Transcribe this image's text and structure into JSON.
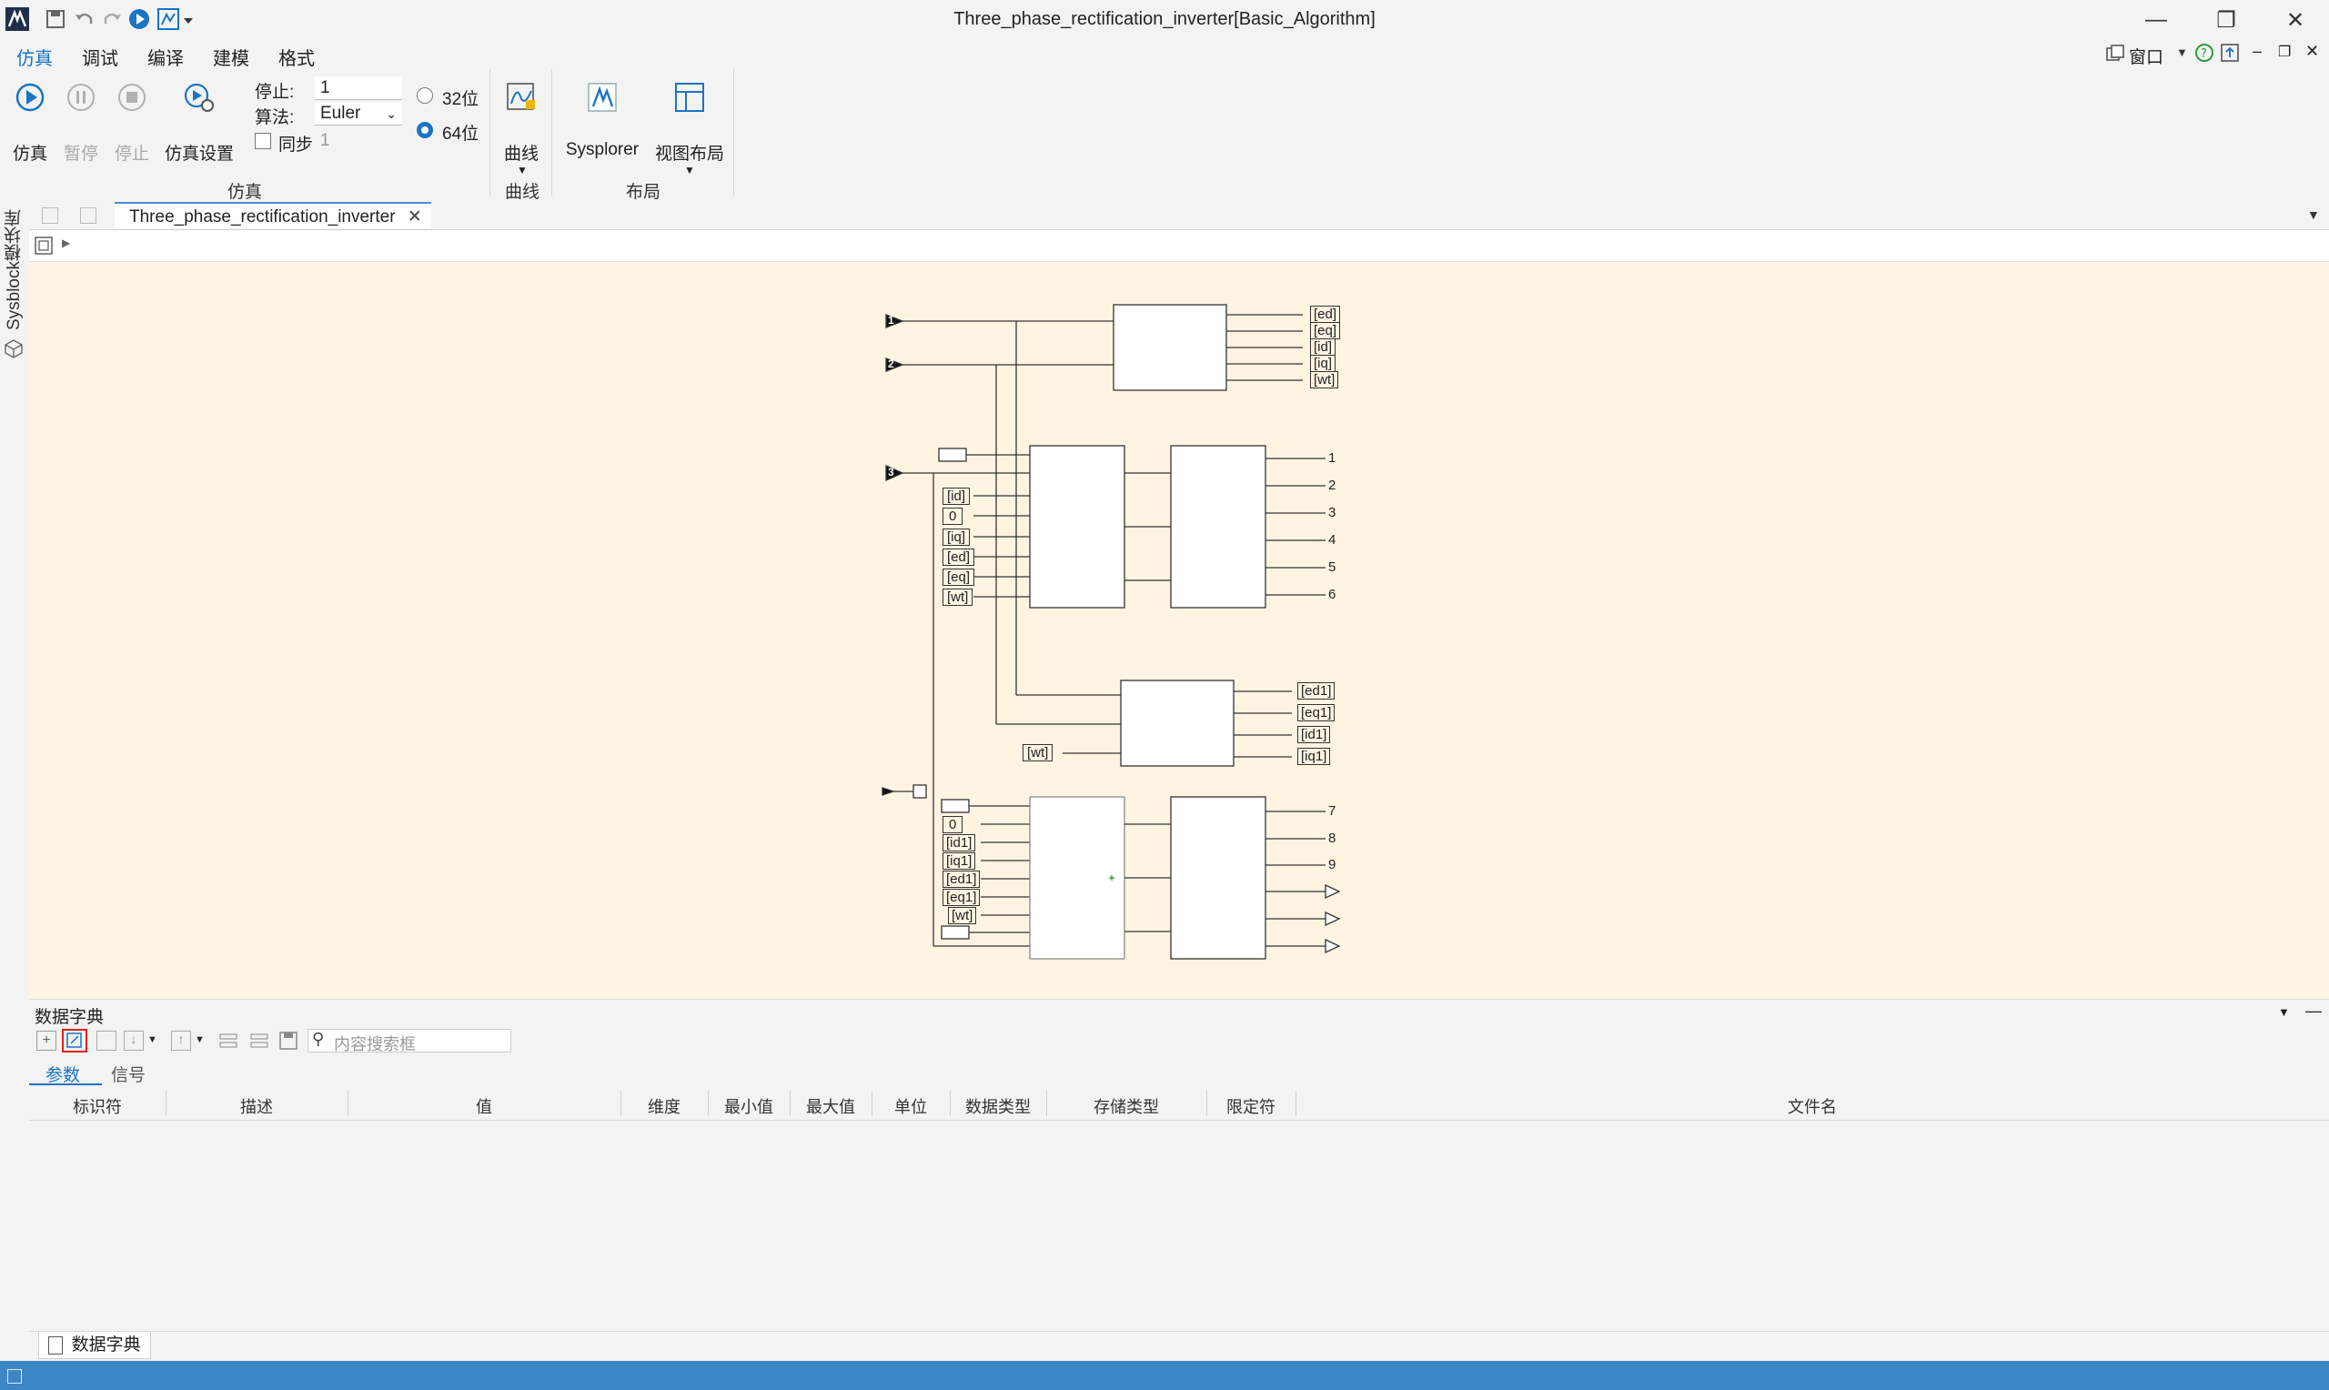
{
  "window": {
    "title": "Three_phase_rectification_inverter[Basic_Algorithm]"
  },
  "menu": [
    "仿真",
    "调试",
    "编译",
    "建模",
    "格式"
  ],
  "topright": {
    "window_label": "窗口"
  },
  "ribbon": {
    "simulate": "仿真",
    "pause": "暂停",
    "stop": "停止",
    "sim_settings": "仿真设置",
    "stop_label": "停止:",
    "stop_value": "1",
    "algo_label": "算法:",
    "algo_value": "Euler",
    "sync_label": "同步",
    "sync_value": "1",
    "bit32": "32位",
    "bit64": "64位",
    "curve": "曲线",
    "sysplorer": "Sysplorer",
    "view_layout": "视图布局",
    "group_sim": "仿真",
    "group_curve": "曲线",
    "group_layout": "布局"
  },
  "sidebar": {
    "label": "Sysblock模块库"
  },
  "tab": {
    "name": "Three_phase_rectification_inverter"
  },
  "diagram": {
    "inports": [
      "1",
      "2",
      "3"
    ],
    "goto_top": [
      "[ed]",
      "[eq]",
      "[id]",
      "[iq]",
      "[wt]"
    ],
    "from_mid": [
      "[id]",
      "0",
      "[iq]",
      "[ed]",
      "[eq]",
      "[wt]"
    ],
    "outports_mid": [
      "1",
      "2",
      "3",
      "4",
      "5",
      "6"
    ],
    "goto_mid2": [
      "[ed1]",
      "[eq1]",
      "[id1]",
      "[iq1]"
    ],
    "from_wt": "[wt]",
    "from_bot": [
      "0",
      "[id1]",
      "[iq1]",
      "[ed1]",
      "[eq1]",
      "[wt]"
    ],
    "outports_bot": [
      "7",
      "8",
      "9"
    ]
  },
  "dict": {
    "title": "数据字典",
    "search_placeholder": "内容搜索框",
    "tabs": [
      "参数",
      "信号"
    ],
    "columns": [
      "标识符",
      "描述",
      "值",
      "维度",
      "最小值",
      "最大值",
      "单位",
      "数据类型",
      "存储类型",
      "限定符",
      "文件名"
    ]
  },
  "bottom_tab": "数据字典",
  "colors": {
    "accent": "#1a73c7",
    "canvas": "#fff4e2",
    "status": "#3d86c6"
  }
}
